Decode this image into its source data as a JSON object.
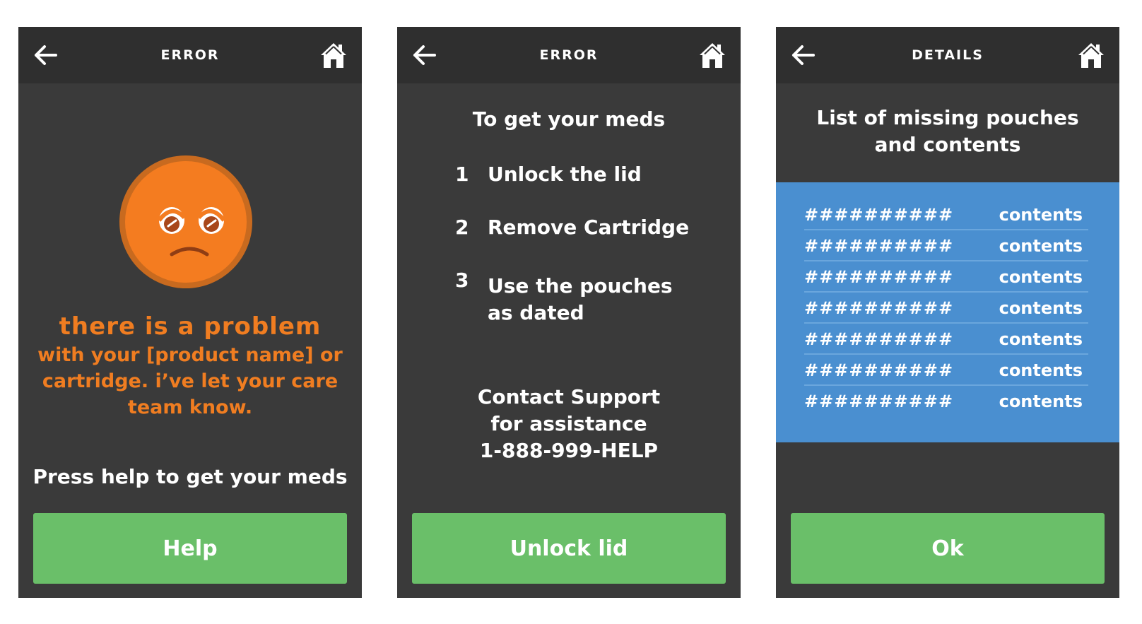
{
  "colors": {
    "screen_background": "#3a3a3a",
    "topbar_background": "#2f2f2f",
    "accent_orange": "#f07d21",
    "button_green": "#6abf69",
    "panel_blue": "#4a8fd0"
  },
  "icons": {
    "back": "arrow-left-icon",
    "home": "home-icon",
    "face": "sad-face-icon"
  },
  "screens": [
    {
      "title": "ERROR",
      "problem_title": "there is a problem",
      "problem_body_lines": [
        "with your [product name] or",
        "cartridge. i’ve let your care",
        "team know."
      ],
      "press_help": "Press help to get your meds",
      "button_label": "Help"
    },
    {
      "title": "ERROR",
      "heading": "To get your meds",
      "steps": [
        {
          "num": "1",
          "lines": [
            "Unlock the lid"
          ]
        },
        {
          "num": "2",
          "lines": [
            "Remove Cartridge"
          ]
        },
        {
          "num": "3",
          "lines": [
            "Use the pouches",
            "as dated"
          ]
        }
      ],
      "contact_lines": [
        "Contact Support",
        "for assistance",
        "1-888-999-HELP"
      ],
      "button_label": "Unlock lid"
    },
    {
      "title": "DETAILS",
      "heading_lines": [
        "List of missing pouches",
        "and contents"
      ],
      "rows": [
        {
          "code": "##########",
          "contents": "contents"
        },
        {
          "code": "##########",
          "contents": "contents"
        },
        {
          "code": "##########",
          "contents": "contents"
        },
        {
          "code": "##########",
          "contents": "contents"
        },
        {
          "code": "##########",
          "contents": "contents"
        },
        {
          "code": "##########",
          "contents": "contents"
        },
        {
          "code": "##########",
          "contents": "contents"
        }
      ],
      "button_label": "Ok"
    }
  ]
}
